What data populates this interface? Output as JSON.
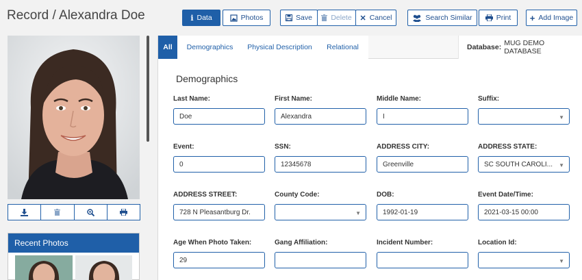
{
  "header": {
    "title": "Record / Alexandra Doe"
  },
  "toolbar": {
    "data_label": "Data",
    "photos_label": "Photos",
    "save_label": "Save",
    "delete_label": "Delete",
    "cancel_label": "Cancel",
    "search_similar_label": "Search Similar",
    "print_label": "Print",
    "add_image_label": "Add Image"
  },
  "sidebar": {
    "recent_photos_title": "Recent Photos",
    "photo_actions": [
      "download-icon",
      "trash-icon",
      "zoom-icon",
      "print-icon"
    ]
  },
  "tabs": [
    {
      "label": "All",
      "active": true
    },
    {
      "label": "Demographics"
    },
    {
      "label": "Physical Description"
    },
    {
      "label": "Relational"
    }
  ],
  "database": {
    "label": "Database:",
    "value": "MUG DEMO DATABASE"
  },
  "section": {
    "title": "Demographics"
  },
  "fields": [
    {
      "label": "Last Name:",
      "value": "Doe",
      "type": "text"
    },
    {
      "label": "First Name:",
      "value": "Alexandra",
      "type": "text"
    },
    {
      "label": "Middle Name:",
      "value": "I",
      "type": "text"
    },
    {
      "label": "Suffix:",
      "value": "",
      "type": "select"
    },
    {
      "label": "Event:",
      "value": "0",
      "type": "text"
    },
    {
      "label": "SSN:",
      "value": "12345678",
      "type": "text"
    },
    {
      "label": "ADDRESS CITY:",
      "value": "Greenville",
      "type": "text"
    },
    {
      "label": "ADDRESS STATE:",
      "value": "SC SOUTH CAROLI...",
      "type": "select"
    },
    {
      "label": "ADDRESS STREET:",
      "value": "728 N Pleasantburg Dr.",
      "type": "text"
    },
    {
      "label": "County Code:",
      "value": "",
      "type": "select"
    },
    {
      "label": "DOB:",
      "value": "1992-01-19",
      "type": "text"
    },
    {
      "label": "Event Date/Time:",
      "value": "2021-03-15 00:00",
      "type": "text"
    },
    {
      "label": "Age When Photo Taken:",
      "value": "29",
      "type": "text"
    },
    {
      "label": "Gang Affiliation:",
      "value": "",
      "type": "text"
    },
    {
      "label": "Incident Number:",
      "value": "",
      "type": "text"
    },
    {
      "label": "Location Id:",
      "value": "",
      "type": "select"
    }
  ],
  "colors": {
    "accent": "#1f5fa8",
    "background": "#f2f2f2"
  }
}
